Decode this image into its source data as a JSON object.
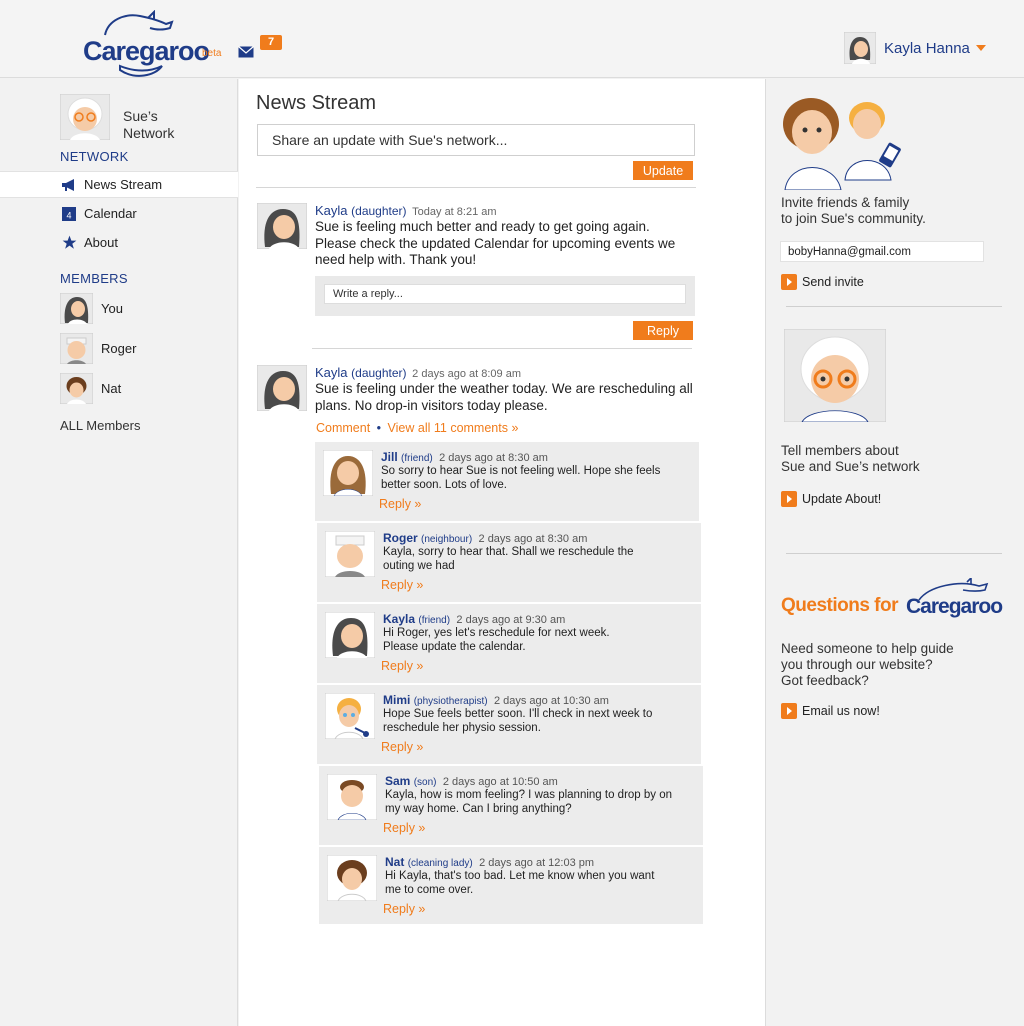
{
  "header": {
    "logo_text": "Caregaroo",
    "logo_beta": "beta",
    "mail_count": "7",
    "user_name": "Kayla Hanna"
  },
  "sidebar": {
    "network_name": "Sue’s Network",
    "network_heading": "NETWORK",
    "nav": [
      {
        "label": "News Stream",
        "icon": "megaphone-icon",
        "active": true
      },
      {
        "label": "Calendar",
        "icon": "calendar-icon",
        "badge": "4"
      },
      {
        "label": "About",
        "icon": "star-icon"
      }
    ],
    "members_heading": "MEMBERS",
    "members": [
      {
        "label": "You"
      },
      {
        "label": "Roger"
      },
      {
        "label": "Nat"
      }
    ],
    "all_members": "ALL Members"
  },
  "main": {
    "title": "News Stream",
    "share_placeholder": "Share an update with Sue's network...",
    "update_label": "Update",
    "posts": [
      {
        "author": "Kayla",
        "relation": "(daughter)",
        "time": "Today at 8:21 am",
        "body": "Sue is feeling much better and ready to get going again. Please check the updated Calendar for upcoming events we need help with. Thank you!",
        "reply_placeholder": "Write a reply...",
        "reply_label": "Reply"
      },
      {
        "author": "Kayla",
        "relation": "(daughter)",
        "time": "2 days ago at 8:09 am",
        "body": "Sue is feeling under the weather today. We are rescheduling all plans. No drop-in visitors today please.",
        "comment_label": "Comment",
        "dot": "•",
        "view_all_label": "View all 11 comments »"
      }
    ],
    "comments": [
      {
        "name": "Jill",
        "relation": "(friend)",
        "time": "2 days ago at 8:30 am",
        "text": "So sorry to hear Sue is not feeling well. Hope she feels better soon. Lots of love.",
        "reply": "Reply »"
      },
      {
        "name": "Roger",
        "relation": "(neighbour)",
        "time": "2 days ago at 8:30 am",
        "text": "Kayla, sorry to hear that. Shall we reschedule the outing we had",
        "reply": "Reply »"
      },
      {
        "name": "Kayla",
        "relation": "(friend)",
        "time": "2 days ago at 9:30 am",
        "text": "Hi Roger, yes let's reschedule for next week. Please update the calendar.",
        "reply": "Reply »"
      },
      {
        "name": "Mimi",
        "relation": "(physiotherapist)",
        "time": "2 days ago at 10:30 am",
        "text": "Hope Sue feels better soon. I'll check in next week to reschedule her physio session.",
        "reply": "Reply »"
      },
      {
        "name": "Sam",
        "relation": "(son)",
        "time": "2 days ago at 10:50 am",
        "text": "Kayla, how is mom feeling?  I was planning to drop by on my way home. Can I bring anything?",
        "reply": "Reply »"
      },
      {
        "name": "Nat",
        "relation": "(cleaning lady)",
        "time": "2 days ago at 12:03 pm",
        "text": "Hi Kayla, that's too bad. Let me know when you want me to come over.",
        "reply": "Reply »"
      }
    ]
  },
  "right": {
    "invite_text_1": "Invite friends & family",
    "invite_text_2": "to join Sue's community.",
    "invite_email": "bobyHanna@gmail.com",
    "send_invite": "Send invite",
    "about_text_1": "Tell members about",
    "about_text_2": "Sue and Sue’s network",
    "update_about": "Update About!",
    "questions_prefix": "Questions for",
    "questions_brand": "Caregaroo",
    "help_text_1": "Need someone to help guide",
    "help_text_2": "you through our website?",
    "help_text_3": "Got feedback?",
    "email_us": "Email us now!"
  },
  "colors": {
    "accent": "#f07c1c",
    "brand": "#1f3c88"
  }
}
